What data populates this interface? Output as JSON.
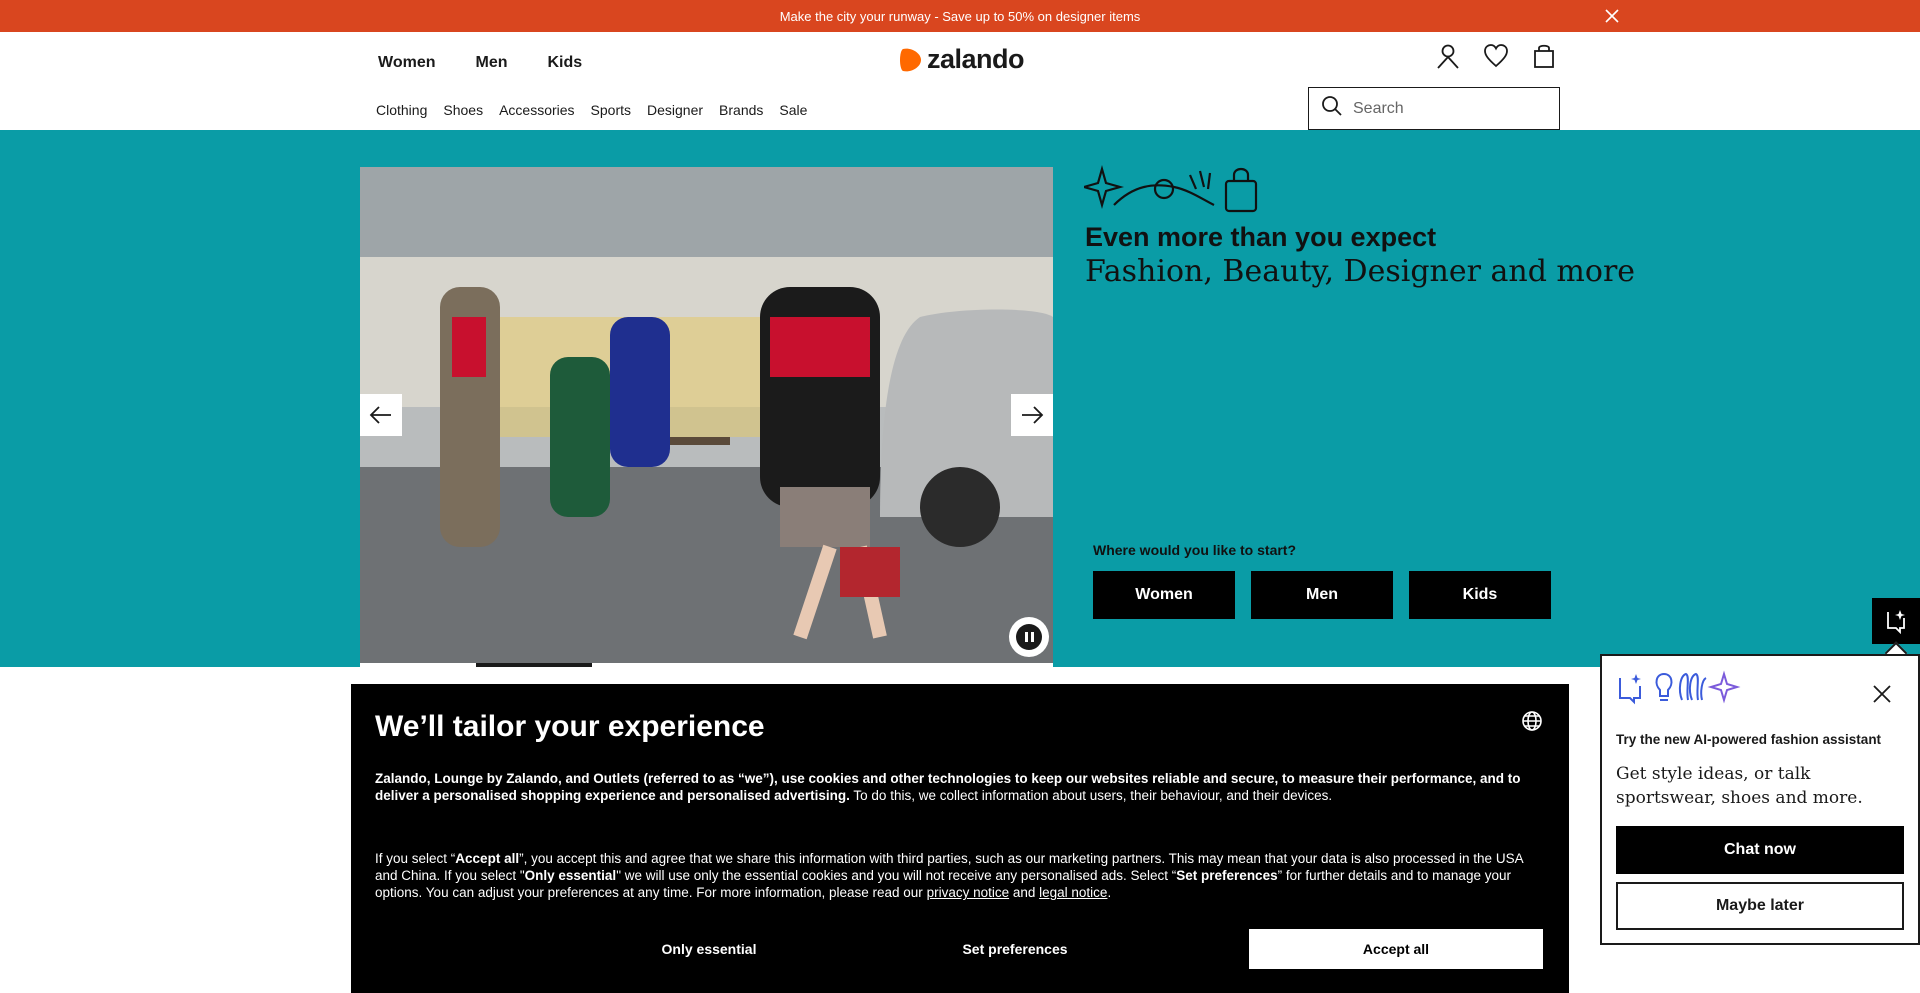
{
  "promo": {
    "text": "Make the city your runway - Save up to 50% on designer items",
    "close_icon": "close-icon"
  },
  "header": {
    "gender_nav": [
      "Women",
      "Men",
      "Kids"
    ],
    "logo_text": "zalando",
    "icons": [
      "user-icon",
      "heart-icon",
      "bag-icon"
    ],
    "categories": [
      "Clothing",
      "Shoes",
      "Accessories",
      "Sports",
      "Designer",
      "Brands",
      "Sale"
    ],
    "search": {
      "placeholder": "Search",
      "icon": "search-icon"
    }
  },
  "hero": {
    "headline": "Even more than you expect",
    "subheadline": "Fashion, Beauty, Designer and more",
    "start_question": "Where would you like to start?",
    "start_buttons": [
      "Women",
      "Men",
      "Kids"
    ],
    "carousel_progress": 0.167,
    "colors": {
      "background": "#0a9ca6"
    }
  },
  "consent": {
    "title": "We’ll tailor your experience",
    "p1_bold": "Zalando, Lounge by Zalando, and Outlets (referred to as “we”), use cookies and other technologies to keep our websites reliable and secure, to measure their performance, and to deliver a personalised shopping experience and personalised advertising.",
    "p1_rest": " To do this, we collect information about users, their behaviour, and their devices.",
    "p2_a": "If you select “",
    "p2_accept": "Accept all",
    "p2_b": "”, you accept this and agree that we share this information with third parties, such as our marketing partners. This may mean that your data is also processed in the USA and China. If you select \"",
    "p2_only": "Only essential",
    "p2_c": "\" we will use only the essential cookies and you will not receive any personalised ads. Select “",
    "p2_prefs": "Set preferences",
    "p2_d": "” for further details and to manage your options. You can adjust your preferences at any time. For more information, please read our ",
    "privacy_link": "privacy notice",
    "p2_and": " and ",
    "legal_link": "legal notice",
    "p2_end": ".",
    "btn_only": "Only essential",
    "btn_prefs": "Set preferences",
    "btn_accept": "Accept all"
  },
  "assistant": {
    "title": "Try the new AI-powered fashion assistant",
    "description": "Get style ideas, or talk sportswear, shoes and more.",
    "chat_label": "Chat now",
    "later_label": "Maybe later",
    "accent_color": "#3b5bdb"
  }
}
